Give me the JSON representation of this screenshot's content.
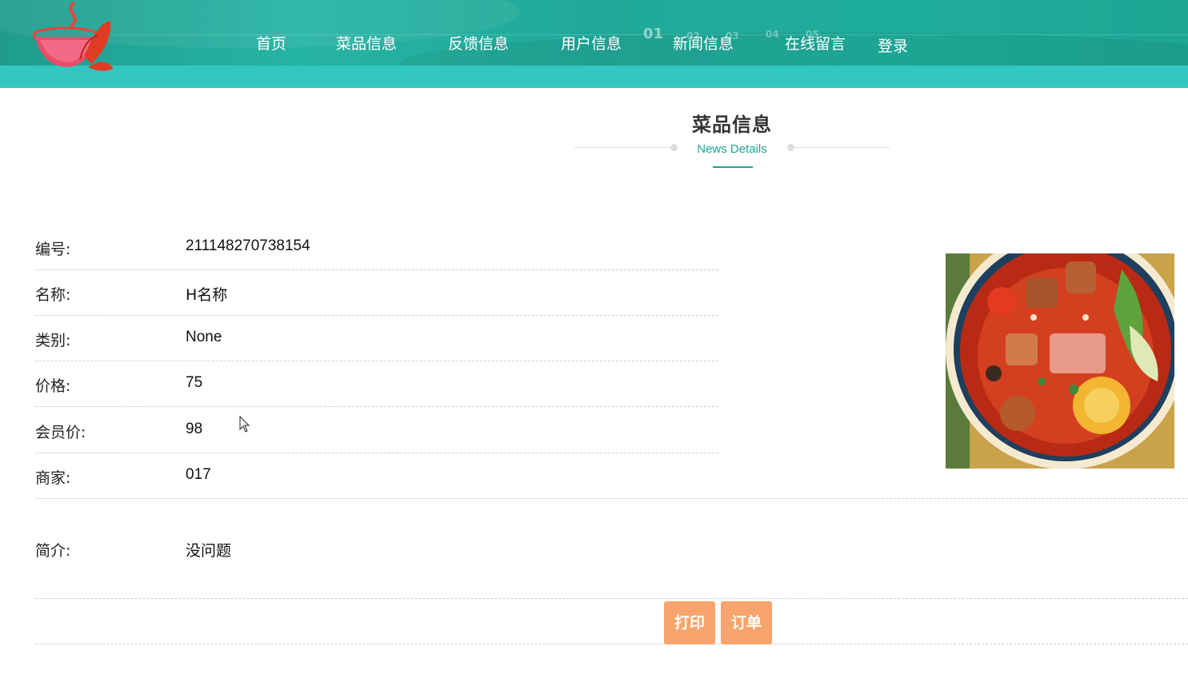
{
  "nav": {
    "items": [
      "首页",
      "菜品信息",
      "反馈信息",
      "用户信息",
      "新闻信息",
      "在线留言"
    ],
    "login": "登录",
    "slide_numbers": [
      "01",
      "02",
      "03",
      "04",
      "05"
    ]
  },
  "section": {
    "title": "菜品信息",
    "subtitle": "News Details"
  },
  "details": [
    {
      "label": "编号:",
      "value": "211148270738154"
    },
    {
      "label": "名称:",
      "value": "H名称"
    },
    {
      "label": "类别:",
      "value": "None"
    },
    {
      "label": "价格:",
      "value": "75"
    },
    {
      "label": "会员价:",
      "value": "98"
    },
    {
      "label": "商家:",
      "value": "017"
    }
  ],
  "intro": {
    "label": "简介:",
    "value": "没问题"
  },
  "buttons": {
    "print": "打印",
    "order": "订单"
  },
  "colors": {
    "header": "#21a898",
    "strip": "#33c7c2",
    "accent": "#1ba394",
    "button": "#f9a46c"
  },
  "icons": {
    "logo": "tea-bowl-logo",
    "cursor": "mouse-pointer-icon"
  }
}
